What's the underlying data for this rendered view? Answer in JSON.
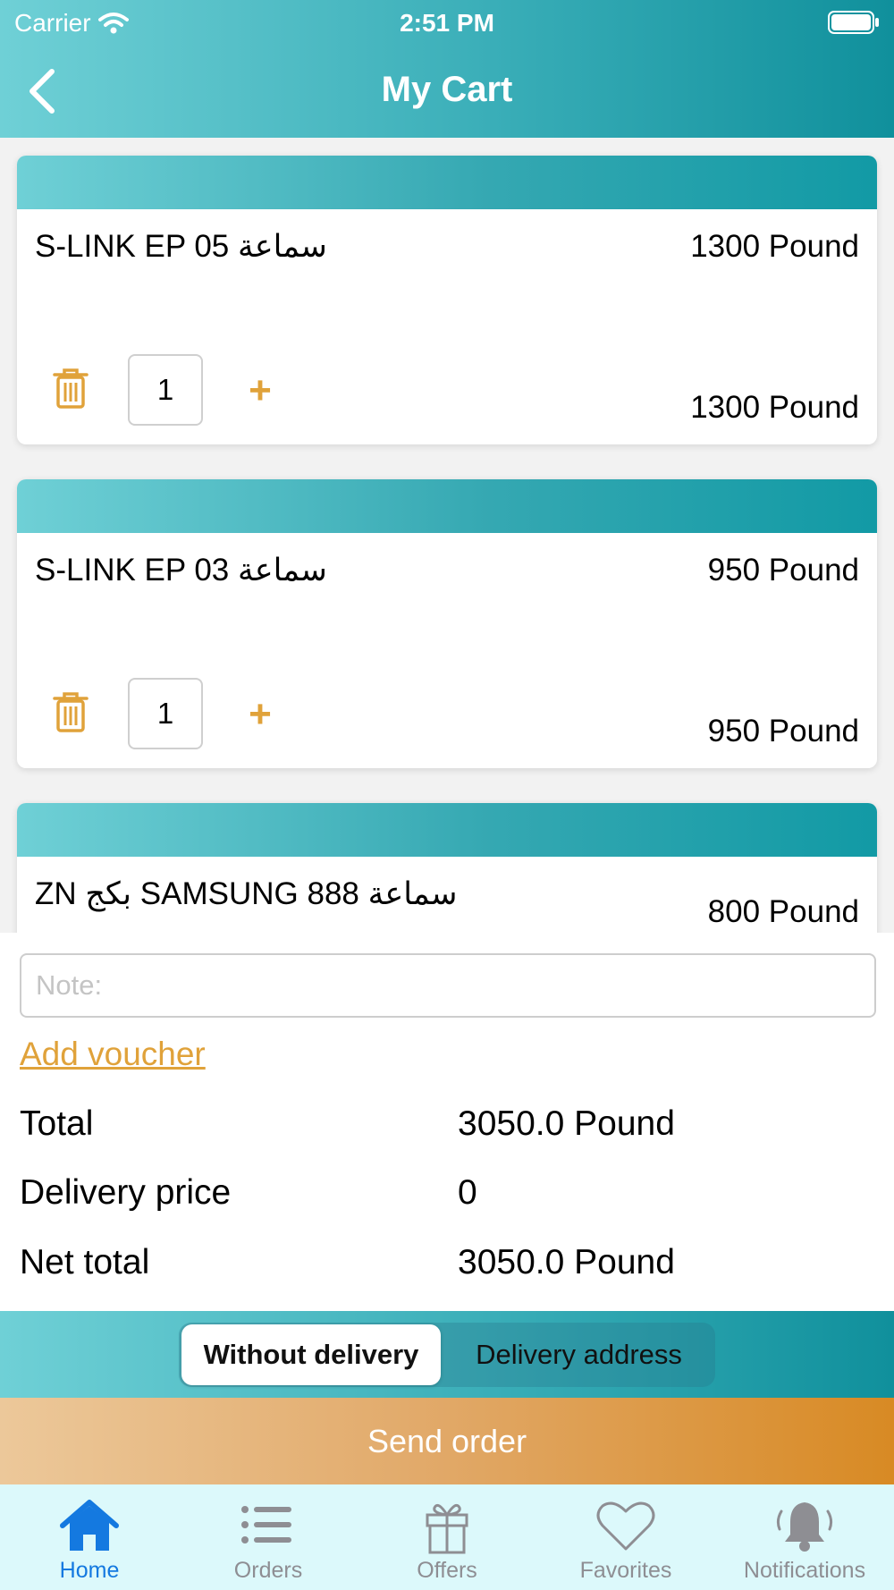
{
  "status_bar": {
    "carrier": "Carrier",
    "time": "2:51 PM"
  },
  "header": {
    "title": "My Cart",
    "back_icon": "chevron-left-icon"
  },
  "cart": {
    "items": [
      {
        "name": "S-LINK EP 05 سماعة",
        "price": "1300 Pound",
        "quantity": "1",
        "subtotal": "1300 Pound"
      },
      {
        "name": "S-LINK EP 03 سماعة",
        "price": "950 Pound",
        "quantity": "1",
        "subtotal": "950 Pound"
      },
      {
        "name": "ZN بكج SAMSUNG سماعة 888",
        "price": "800 Pound"
      }
    ]
  },
  "summary": {
    "note_placeholder": "Note:",
    "voucher_label": "Add voucher",
    "total_label": "Total",
    "total_value": "3050.0 Pound",
    "delivery_label": "Delivery price",
    "delivery_value": "0",
    "net_label": "Net total",
    "net_value": "3050.0 Pound"
  },
  "delivery_toggle": {
    "selected": "Without delivery",
    "other": "Delivery address"
  },
  "send_order_label": "Send order",
  "tabs": [
    {
      "label": "Home",
      "icon": "home-icon",
      "active": true
    },
    {
      "label": "Orders",
      "icon": "list-icon",
      "active": false
    },
    {
      "label": "Offers",
      "icon": "gift-icon",
      "active": false
    },
    {
      "label": "Favorites",
      "icon": "heart-icon",
      "active": false
    },
    {
      "label": "Notifications",
      "icon": "bell-icon",
      "active": false
    }
  ],
  "colors": {
    "teal": "#3aaeb8",
    "accent_orange": "#e0a23a",
    "active_tab": "#1479e0",
    "inactive_tab": "#8e8e93"
  }
}
